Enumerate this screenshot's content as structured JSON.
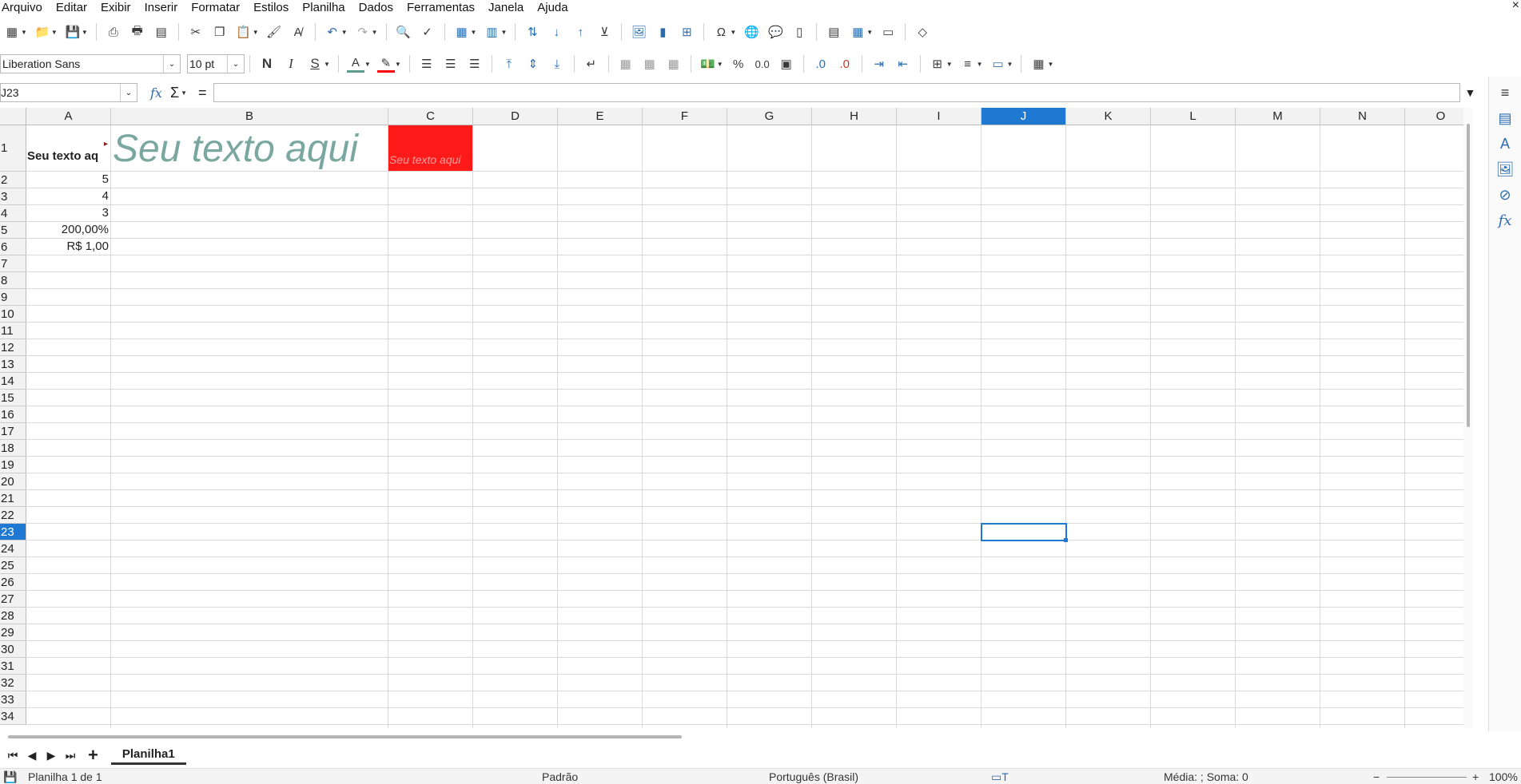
{
  "menu": [
    "Arquivo",
    "Editar",
    "Exibir",
    "Inserir",
    "Formatar",
    "Estilos",
    "Planilha",
    "Dados",
    "Ferramentas",
    "Janela",
    "Ajuda"
  ],
  "toolbar2": {
    "font_name": "Liberation Sans",
    "font_size": "10 pt",
    "bold": "N",
    "italic": "I",
    "underline": "S",
    "percent": "%",
    "decimal": "0.0"
  },
  "formula": {
    "cell_ref": "J23",
    "value": ""
  },
  "columns": [
    "A",
    "B",
    "C",
    "D",
    "E",
    "F",
    "G",
    "H",
    "I",
    "J",
    "K",
    "L",
    "M",
    "N",
    "O"
  ],
  "selected_column": "J",
  "rows": [
    "1",
    "2",
    "3",
    "4",
    "5",
    "6",
    "7",
    "8",
    "9",
    "10",
    "11",
    "12",
    "13",
    "14",
    "15",
    "16",
    "17",
    "18",
    "19",
    "20",
    "21",
    "22",
    "23",
    "24",
    "25",
    "26",
    "27",
    "28",
    "29",
    "30",
    "31",
    "32",
    "33",
    "34"
  ],
  "selected_row": "23",
  "cells": {
    "A1": "Seu texto aq",
    "B1": "Seu texto aqui",
    "C1": "Seu texto aqui",
    "A2": "5",
    "A3": "4",
    "A4": "3",
    "A5": "200,00%",
    "A6": "R$ 1,00"
  },
  "colors": {
    "accent": "#1f78d1",
    "b1_text": "#7aa8a0",
    "c1_fill": "#ff1a1a",
    "c1_text": "#f0a0a0"
  },
  "sheet_tab": "Planilha1",
  "status": {
    "sheet_info": "Planilha 1 de 1",
    "style": "Padrão",
    "language": "Português (Brasil)",
    "summary": "Média: ; Soma: 0",
    "zoom": "100%"
  }
}
